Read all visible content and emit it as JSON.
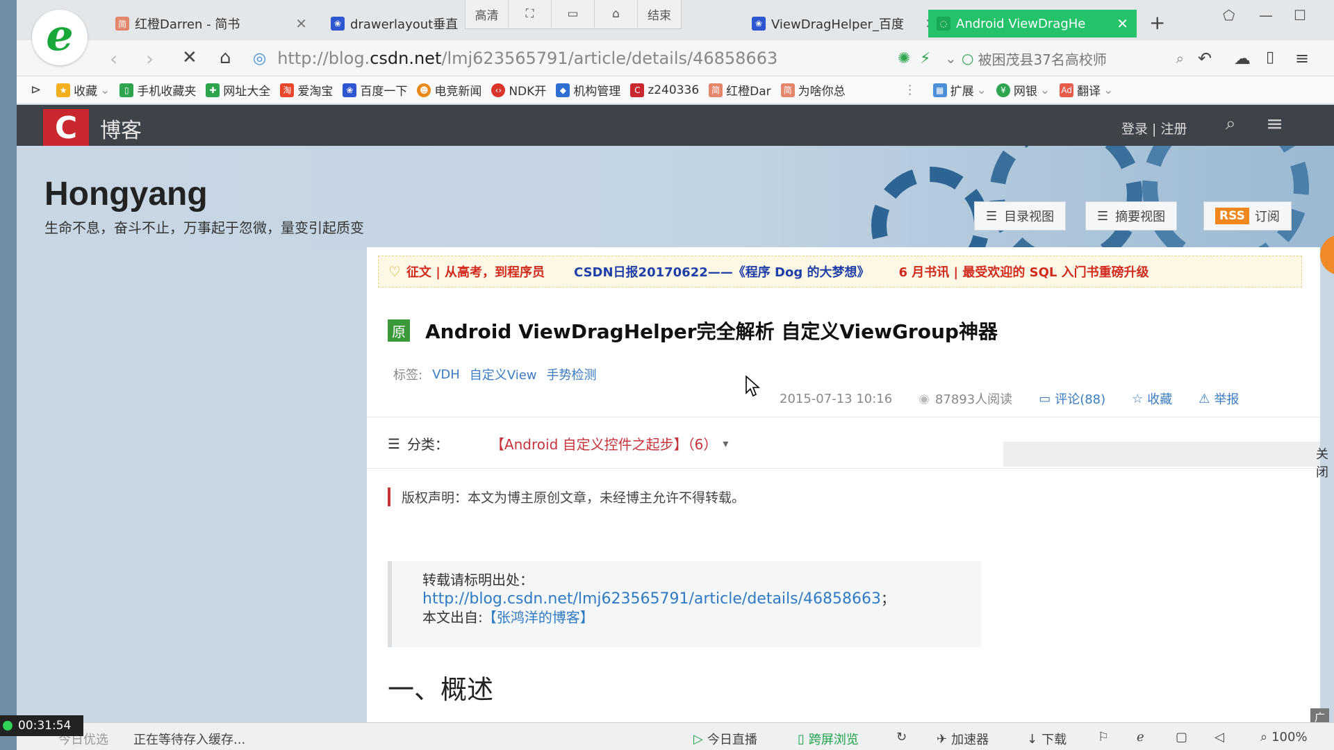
{
  "tabs": [
    {
      "title": "红橙Darren - 简书",
      "favicon": "jianshu-icon",
      "active": false
    },
    {
      "title": "drawerlayout垂直",
      "favicon": "baidu-paw-icon",
      "active": false
    },
    {
      "title": "ViewDragHelper_百度",
      "favicon": "baidu-paw-icon",
      "active": false
    },
    {
      "title": "Android ViewDragHe",
      "favicon": "csdn-icon",
      "active": true
    }
  ],
  "recorder_toolbar": {
    "quality": "高清",
    "region": "⛶",
    "window": "▭",
    "home": "⌂",
    "end": "结束"
  },
  "address_bar": {
    "url_prefix": "http://blog.",
    "url_domain": "csdn.net",
    "url_suffix": "/lmj623565791/article/details/46858663",
    "search_text": "被困茂县37名高校师"
  },
  "bookmarks": [
    {
      "label": "收藏",
      "icon": "star-icon",
      "color": "#f2b01e"
    },
    {
      "label": "手机收藏夹",
      "icon": "phone-icon",
      "color": "#2ea44f"
    },
    {
      "label": "网址大全",
      "icon": "web-icon",
      "color": "#2ea44f"
    },
    {
      "label": "爱淘宝",
      "icon": "taobao-icon",
      "color": "#e8452c"
    },
    {
      "label": "百度一下",
      "icon": "baidu-paw-icon",
      "color": "#2f56d1"
    },
    {
      "label": "电竞新闻",
      "icon": "game-icon",
      "color": "#e88a1c"
    },
    {
      "label": "NDK开",
      "icon": "csdn-icon",
      "color": "#d9352b"
    },
    {
      "label": "机构管理",
      "icon": "diamond-icon",
      "color": "#2f6fd1"
    },
    {
      "label": "z240336",
      "icon": "csdn-icon",
      "color": "#c9282e"
    },
    {
      "label": "红橙Dar",
      "icon": "jianshu-icon",
      "color": "#e4866b"
    },
    {
      "label": "为啥你总",
      "icon": "jianshu-icon",
      "color": "#e4866b"
    }
  ],
  "bookmarks_right": [
    {
      "label": "扩展",
      "icon": "extension-icon"
    },
    {
      "label": "网银",
      "icon": "bank-icon"
    },
    {
      "label": "翻译",
      "icon": "translate-icon"
    }
  ],
  "csdn": {
    "logo": "C",
    "blog_label": "博客",
    "login": "登录 | 注册"
  },
  "banner": {
    "author": "Hongyang",
    "motto": "生命不息，奋斗不止，万事起于忽微，量变引起质变",
    "catalog_view": "目录视图",
    "summary_view": "摘要视图",
    "rss": "RSS",
    "subscribe": "订阅"
  },
  "notices": [
    {
      "text": "征文 | 从高考，到程序员",
      "color": "#d12a1f"
    },
    {
      "text": "CSDN日报20170622——《程序 Dog 的大梦想》",
      "color": "#1f3fa8"
    },
    {
      "text": "6 月书讯 | 最受欢迎的 SQL 入门书重磅升级",
      "color": "#d12a1f"
    }
  ],
  "article": {
    "badge": "原",
    "title": "Android ViewDragHelper完全解析 自定义ViewGroup神器",
    "tags_label": "标签:",
    "tags": [
      "VDH",
      "自定义View",
      "手势检测"
    ],
    "date": "2015-07-13 10:16",
    "reads": "87893人阅读",
    "comments": "评论(88)",
    "favorite": "收藏",
    "report": "举报",
    "category_label": "分类：",
    "category_value": "【Android 自定义控件之起步】（6）",
    "close_ad": "关闭",
    "copyright": "版权声明：本文为博主原创文章，未经博主允许不得转载。",
    "repost_label": "转载请标明出处：",
    "repost_url": "http://blog.csdn.net/lmj623565791/article/details/46858663",
    "repost_url_suffix": "；",
    "source_label": "本文出自:",
    "source_link": "【张鸿洋的博客】",
    "section_heading": "一、概述",
    "ad_label": "广告"
  },
  "timer": "00:31:54",
  "statusbar": {
    "today_prefix": "今日优选",
    "waiting": "正在等待存入缓存...",
    "live": "今日直播",
    "cross_screen": "跨屏浏览",
    "accelerator": "加速器",
    "download": "下载",
    "zoom": "100%"
  }
}
